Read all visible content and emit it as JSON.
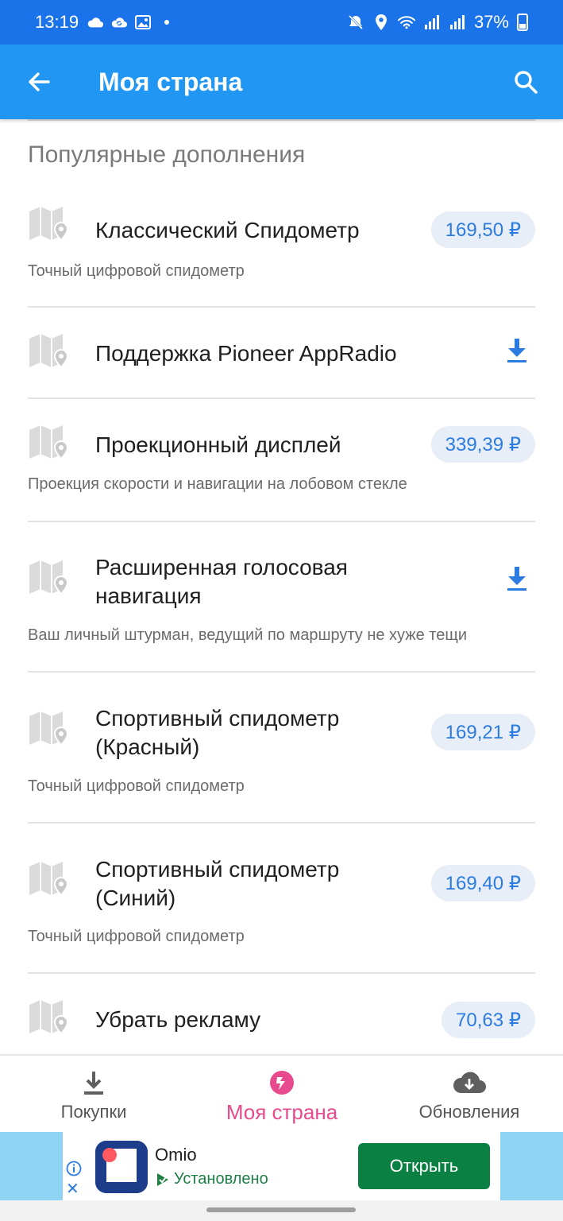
{
  "status_bar": {
    "time": "13:19",
    "battery": "37%",
    "icons": [
      "cloud-icon",
      "sync-cloud-icon",
      "image-icon",
      "dot-icon",
      "mute-icon",
      "location-icon",
      "wifi-icon",
      "signal-icon",
      "signal-icon",
      "battery-icon"
    ]
  },
  "app_bar": {
    "title": "Моя страна",
    "back_icon": "arrow-left-icon",
    "search_icon": "search-icon"
  },
  "section_title": "Популярные дополнения",
  "items": [
    {
      "name_lines": [
        "Классический Спидометр"
      ],
      "desc": "Точный цифровой спидометр",
      "price": "169,50 ₽",
      "action": "price"
    },
    {
      "name_lines": [
        "Поддержка Pioneer AppRadio"
      ],
      "desc": "",
      "price": "",
      "action": "download"
    },
    {
      "name_lines": [
        "Проекционный дисплей"
      ],
      "desc": "Проекция скорости и навигации на лобовом стекле",
      "price": "339,39 ₽",
      "action": "price"
    },
    {
      "name_lines": [
        "Расширенная голосовая",
        "навигация"
      ],
      "desc": "Ваш личный штурман, ведущий по маршруту не хуже тещи",
      "price": "",
      "action": "download"
    },
    {
      "name_lines": [
        "Спортивный спидометр",
        "(Красный)"
      ],
      "desc": "Точный цифровой спидометр",
      "price": "169,21 ₽",
      "action": "price"
    },
    {
      "name_lines": [
        "Спортивный спидометр",
        "(Синий)"
      ],
      "desc": "Точный цифровой спидометр",
      "price": "169,40 ₽",
      "action": "price"
    },
    {
      "name_lines": [
        "Убрать рекламу"
      ],
      "desc": "",
      "price": "70,63 ₽",
      "action": "price"
    }
  ],
  "bottom_nav": {
    "purchases": "Покупки",
    "my_country": "Моя страна",
    "updates": "Обновления"
  },
  "ad": {
    "app_name": "Omio",
    "status": "Установлено",
    "button": "Открыть"
  },
  "colors": {
    "status_bar": "#1a73e8",
    "app_bar": "#2196f3",
    "price_text": "#2b7be0",
    "price_bg": "#e8eef7",
    "active_nav": "#e84a8e",
    "ad_button": "#0b8043"
  }
}
